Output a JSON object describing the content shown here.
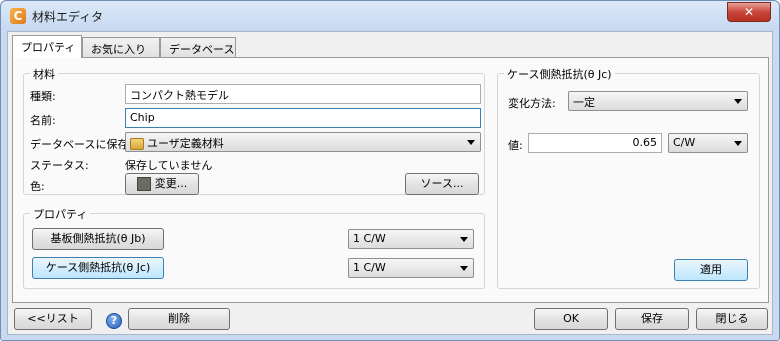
{
  "window": {
    "title": "材料エディタ",
    "app_icon_glyph": "C",
    "close_glyph": "✕"
  },
  "tabs": [
    {
      "label": "プロパティ",
      "active": true
    },
    {
      "label": "お気に入り",
      "active": false
    },
    {
      "label": "データベース",
      "active": false
    }
  ],
  "material": {
    "legend": "材料",
    "type_label": "種類:",
    "type_value": "コンパクト熱モデル",
    "name_label": "名前:",
    "name_value": "Chip",
    "save_label": "データベースに保存:",
    "save_value": "ユーザ定義材料",
    "status_label": "ステータス:",
    "status_value": "保存していません",
    "color_label": "色:",
    "change_button": "変更...",
    "source_button": "ソース..."
  },
  "properties": {
    "legend": "プロパティ",
    "rows": [
      {
        "button": "基板側熱抵抗(θ Jb)",
        "unit": "1 C/W",
        "selected": false
      },
      {
        "button": "ケース側熱抵抗(θ Jc)",
        "unit": "1 C/W",
        "selected": true
      }
    ]
  },
  "detail": {
    "legend": "ケース側熱抵抗(θ Jc)",
    "method_label": "変化方法:",
    "method_value": "一定",
    "value_label": "値:",
    "value": "0.65",
    "unit_value": "C/W",
    "apply_button": "適用"
  },
  "footer": {
    "list_button": "<<リスト",
    "help_glyph": "?",
    "delete_button": "削除",
    "ok_button": "OK",
    "save_button": "保存",
    "close_button": "閉じる"
  }
}
